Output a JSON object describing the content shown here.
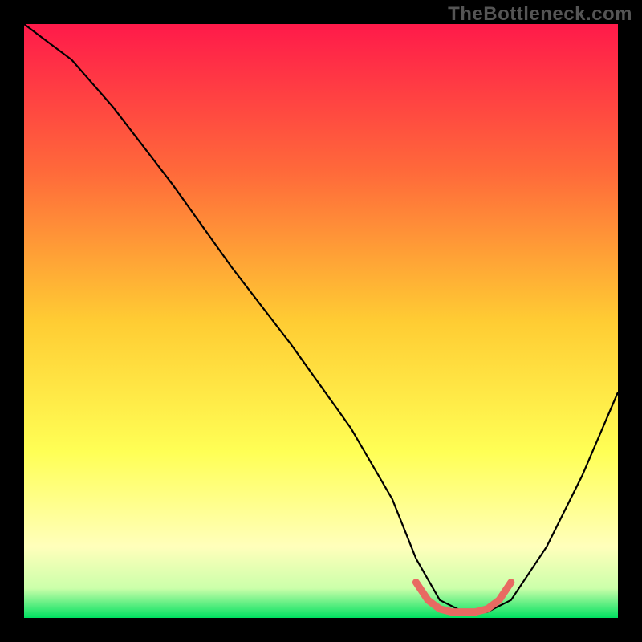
{
  "watermark": "TheBottleneck.com",
  "chart_data": {
    "type": "line",
    "title": "",
    "xlabel": "",
    "ylabel": "",
    "xlim": [
      0,
      100
    ],
    "ylim": [
      0,
      100
    ],
    "grid": false,
    "legend": false,
    "gradient_stops": [
      {
        "offset": 0,
        "color": "#ff1a4a"
      },
      {
        "offset": 0.25,
        "color": "#ff6a3a"
      },
      {
        "offset": 0.5,
        "color": "#ffcc33"
      },
      {
        "offset": 0.72,
        "color": "#ffff55"
      },
      {
        "offset": 0.88,
        "color": "#ffffbb"
      },
      {
        "offset": 0.95,
        "color": "#ccffaa"
      },
      {
        "offset": 1.0,
        "color": "#00e060"
      }
    ],
    "series": [
      {
        "name": "bottleneck-curve",
        "color": "#000000",
        "x": [
          0,
          4,
          8,
          15,
          25,
          35,
          45,
          55,
          62,
          66,
          70,
          74,
          78,
          82,
          88,
          94,
          100
        ],
        "y": [
          100,
          97,
          94,
          86,
          73,
          59,
          46,
          32,
          20,
          10,
          3,
          1,
          1,
          3,
          12,
          24,
          38
        ]
      }
    ],
    "highlight_segment": {
      "name": "optimal-zone",
      "color": "#e86a62",
      "x": [
        66,
        68,
        70,
        72,
        74,
        76,
        78,
        80,
        82
      ],
      "y": [
        6,
        3,
        1.5,
        1,
        1,
        1,
        1.5,
        3,
        6
      ]
    }
  }
}
